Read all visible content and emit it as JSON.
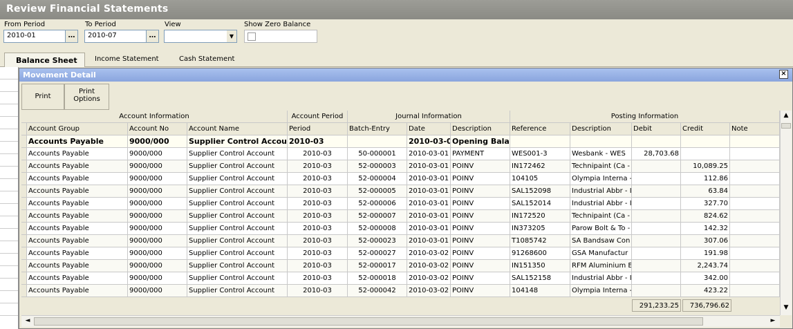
{
  "window": {
    "title": "Review Financial Statements"
  },
  "filters": {
    "from_period_label": "From Period",
    "from_period_value": "2010-01",
    "to_period_label": "To Period",
    "to_period_value": "2010-07",
    "view_label": "View",
    "view_value": "",
    "show_zero_label": "Show Zero Balance",
    "ellipsis": "…",
    "dropdown_arrow": "▼"
  },
  "tabs": [
    {
      "label": "Balance Sheet",
      "active": true
    },
    {
      "label": "Income Statement",
      "active": false
    },
    {
      "label": "Cash Statement",
      "active": false
    }
  ],
  "panel": {
    "title": "Movement Detail",
    "close": "×"
  },
  "toolbar": {
    "print": "Print",
    "print_options_1": "Print",
    "print_options_2": "Options"
  },
  "groups": [
    {
      "label": "Account Information"
    },
    {
      "label": "Account Period"
    },
    {
      "label": "Journal Information"
    },
    {
      "label": "Posting Information"
    }
  ],
  "columns": [
    "Account Group",
    "Account No",
    "Account Name",
    "Period",
    "Batch-Entry",
    "Date",
    "Description",
    "Reference",
    "Description",
    "Debit",
    "Credit",
    "Note"
  ],
  "summary_row": [
    "Accounts Payable",
    "9000/000",
    "Supplier Control Account",
    "2010-03",
    "",
    "2010-03-0",
    "Opening Balan",
    "",
    "",
    "",
    "",
    ""
  ],
  "rows": [
    [
      "Accounts Payable",
      "9000/000",
      "Supplier Control Account",
      "2010-03",
      "50-000001",
      "2010-03-01",
      "PAYMENT",
      "WES001-3",
      "Wesbank - WES",
      "28,703.68",
      "",
      ""
    ],
    [
      "Accounts Payable",
      "9000/000",
      "Supplier Control Account",
      "2010-03",
      "52-000003",
      "2010-03-01",
      "POINV",
      "IN172462",
      "Technipaint (Ca -",
      "",
      "10,089.25",
      ""
    ],
    [
      "Accounts Payable",
      "9000/000",
      "Supplier Control Account",
      "2010-03",
      "52-000004",
      "2010-03-01",
      "POINV",
      "104105",
      "Olympia Interna -",
      "",
      "112.86",
      ""
    ],
    [
      "Accounts Payable",
      "9000/000",
      "Supplier Control Account",
      "2010-03",
      "52-000005",
      "2010-03-01",
      "POINV",
      "SAL152098",
      "Industrial Abbr - If",
      "",
      "63.84",
      ""
    ],
    [
      "Accounts Payable",
      "9000/000",
      "Supplier Control Account",
      "2010-03",
      "52-000006",
      "2010-03-01",
      "POINV",
      "SAL152014",
      "Industrial Abbr - If",
      "",
      "327.70",
      ""
    ],
    [
      "Accounts Payable",
      "9000/000",
      "Supplier Control Account",
      "2010-03",
      "52-000007",
      "2010-03-01",
      "POINV",
      "IN172520",
      "Technipaint (Ca -",
      "",
      "824.62",
      ""
    ],
    [
      "Accounts Payable",
      "9000/000",
      "Supplier Control Account",
      "2010-03",
      "52-000008",
      "2010-03-01",
      "POINV",
      "IN373205",
      "Parow Bolt & To -",
      "",
      "142.32",
      ""
    ],
    [
      "Accounts Payable",
      "9000/000",
      "Supplier Control Account",
      "2010-03",
      "52-000023",
      "2010-03-01",
      "POINV",
      "T1085742",
      "SA Bandsaw Con",
      "",
      "307.06",
      ""
    ],
    [
      "Accounts Payable",
      "9000/000",
      "Supplier Control Account",
      "2010-03",
      "52-000027",
      "2010-03-02",
      "POINV",
      "91268600",
      "GSA  Manufactur",
      "",
      "191.98",
      ""
    ],
    [
      "Accounts Payable",
      "9000/000",
      "Supplier Control Account",
      "2010-03",
      "52-000017",
      "2010-03-02",
      "POINV",
      "IN151350",
      "RFM Aluminium E",
      "",
      "2,243.74",
      ""
    ],
    [
      "Accounts Payable",
      "9000/000",
      "Supplier Control Account",
      "2010-03",
      "52-000018",
      "2010-03-02",
      "POINV",
      "SAL152158",
      "Industrial Abbr - If",
      "",
      "342.00",
      ""
    ],
    [
      "Accounts Payable",
      "9000/000",
      "Supplier Control Account",
      "2010-03",
      "52-000042",
      "2010-03-02",
      "POINV",
      "104148",
      "Olympia Interna -",
      "",
      "423.22",
      ""
    ]
  ],
  "totals": {
    "debit": "291,233.25",
    "credit": "736,796.62"
  },
  "scroll": {
    "up": "▲",
    "down": "▼",
    "left": "◄",
    "right": "►"
  }
}
